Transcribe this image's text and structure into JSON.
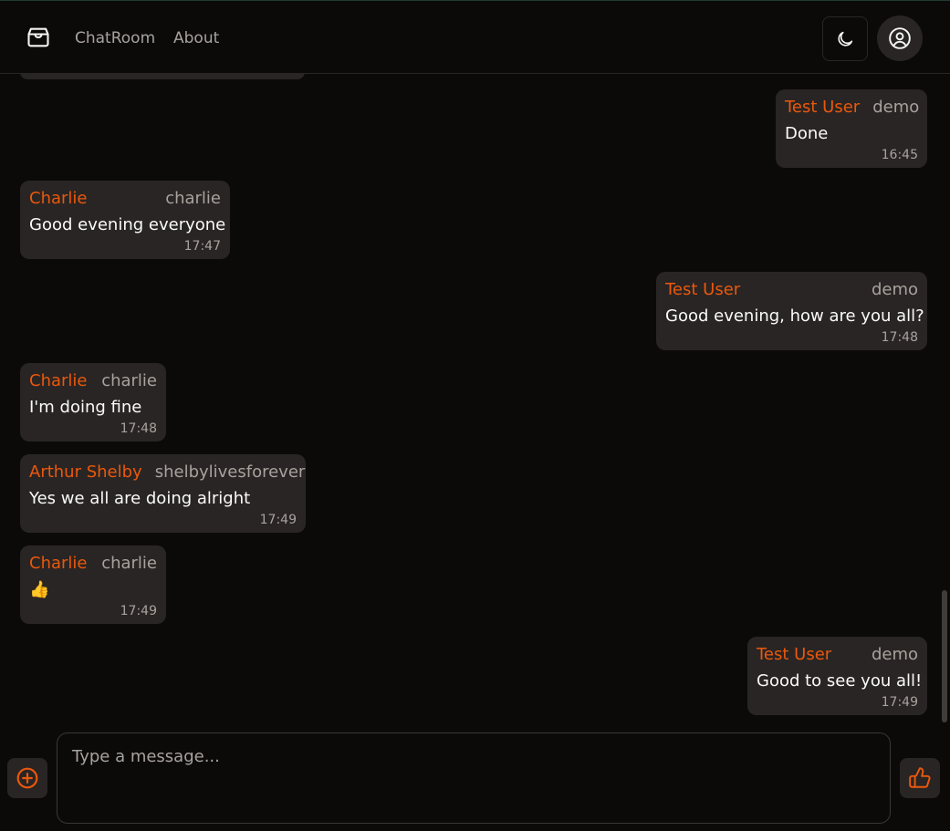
{
  "colors": {
    "background": "#0c0a09",
    "bubble": "#292524",
    "accent": "#ea580c",
    "muted": "#a8a29e"
  },
  "header": {
    "logo_icon": "package-icon",
    "nav": [
      {
        "label": "ChatRoom"
      },
      {
        "label": "About"
      }
    ],
    "theme_toggle_icon": "moon-icon",
    "user_menu_icon": "user-circle-icon"
  },
  "messages": [
    {
      "side": "right",
      "name": "Test User",
      "username": "demo",
      "text": "Done",
      "time": "16:45"
    },
    {
      "side": "left",
      "name": "Charlie",
      "username": "charlie",
      "text": "Good evening everyone",
      "time": "17:47"
    },
    {
      "side": "right",
      "name": "Test User",
      "username": "demo",
      "text": "Good evening, how are you all?",
      "time": "17:48"
    },
    {
      "side": "left",
      "name": "Charlie",
      "username": "charlie",
      "text": "I'm doing fine",
      "time": "17:48"
    },
    {
      "side": "left",
      "name": "Arthur Shelby",
      "username": "shelbylivesforever",
      "text": "Yes we all are doing alright",
      "time": "17:49"
    },
    {
      "side": "left",
      "name": "Charlie",
      "username": "charlie",
      "text": "👍",
      "time": "17:49"
    },
    {
      "side": "right",
      "name": "Test User",
      "username": "demo",
      "text": "Good to see you all!",
      "time": "17:49"
    }
  ],
  "composer": {
    "add_icon": "plus-circle-icon",
    "placeholder": "Type a message...",
    "value": "",
    "send_icon": "thumbs-up-icon"
  }
}
